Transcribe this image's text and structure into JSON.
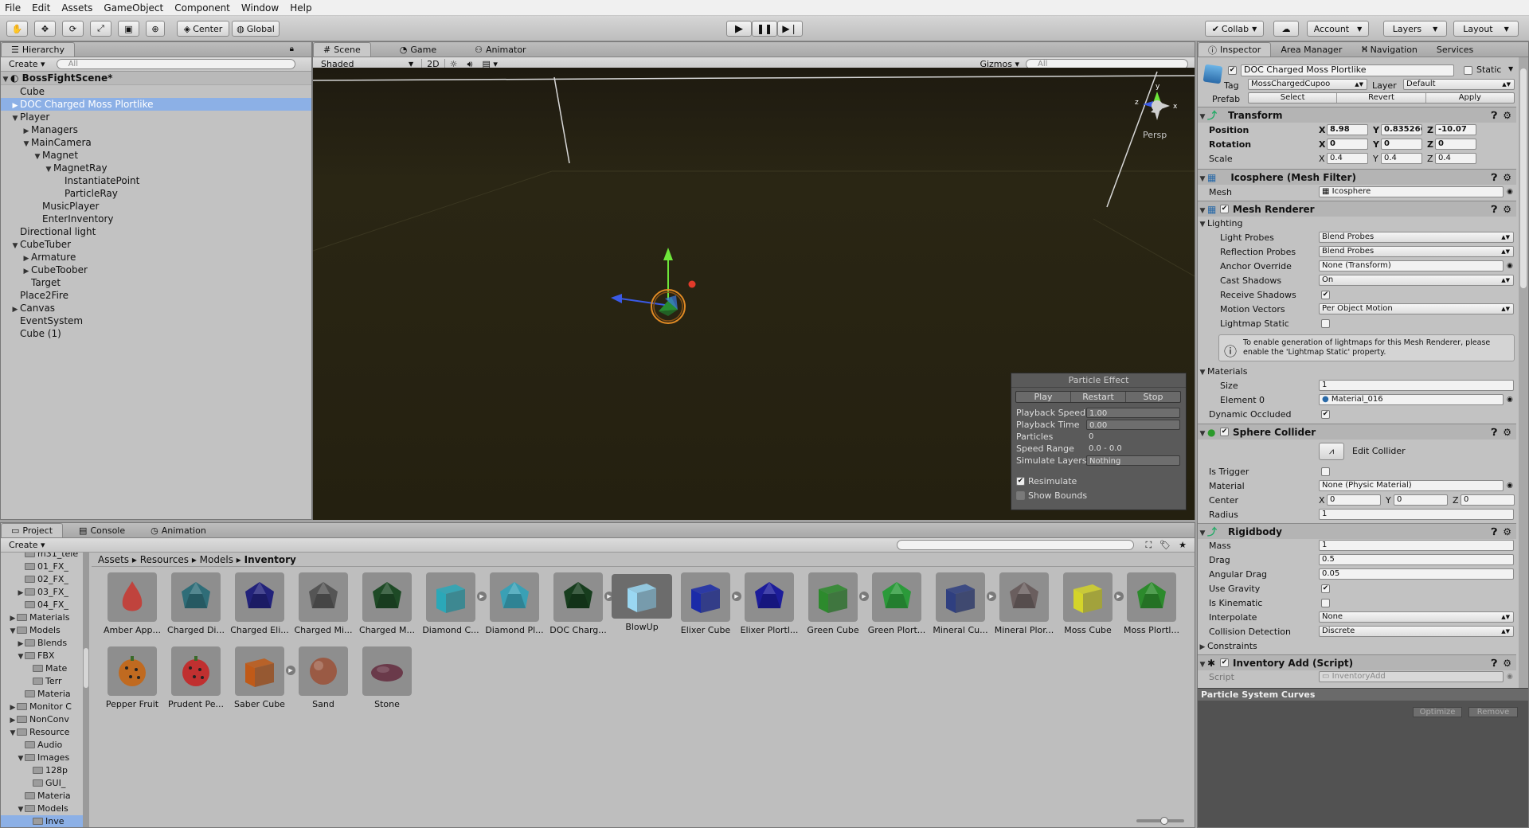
{
  "menu": [
    "File",
    "Edit",
    "Assets",
    "GameObject",
    "Component",
    "Window",
    "Help"
  ],
  "toolbar": {
    "pivot": "Center",
    "space": "Global",
    "collab": "Collab",
    "account": "Account",
    "layers": "Layers",
    "layout": "Layout"
  },
  "hierarchy": {
    "tab": "Hierarchy",
    "create": "Create",
    "search": "All",
    "scene": "BossFightScene*",
    "items": [
      {
        "label": "Cube",
        "depth": 0,
        "arrow": ""
      },
      {
        "label": "DOC Charged Moss Plortlike",
        "depth": 0,
        "arrow": "▶",
        "selected": true
      },
      {
        "label": "Player",
        "depth": 0,
        "arrow": "▼"
      },
      {
        "label": "Managers",
        "depth": 1,
        "arrow": "▶"
      },
      {
        "label": "MainCamera",
        "depth": 1,
        "arrow": "▼"
      },
      {
        "label": "Magnet",
        "depth": 2,
        "arrow": "▼"
      },
      {
        "label": "MagnetRay",
        "depth": 3,
        "arrow": "▼"
      },
      {
        "label": "InstantiatePoint",
        "depth": 4,
        "arrow": ""
      },
      {
        "label": "ParticleRay",
        "depth": 4,
        "arrow": ""
      },
      {
        "label": "MusicPlayer",
        "depth": 2,
        "arrow": ""
      },
      {
        "label": "EnterInventory",
        "depth": 2,
        "arrow": ""
      },
      {
        "label": "Directional light",
        "depth": 0,
        "arrow": ""
      },
      {
        "label": "CubeTuber",
        "depth": 0,
        "arrow": "▼"
      },
      {
        "label": "Armature",
        "depth": 1,
        "arrow": "▶"
      },
      {
        "label": "CubeToober",
        "depth": 1,
        "arrow": "▶"
      },
      {
        "label": "Target",
        "depth": 1,
        "arrow": ""
      },
      {
        "label": "Place2Fire",
        "depth": 0,
        "arrow": ""
      },
      {
        "label": "Canvas",
        "depth": 0,
        "arrow": "▶"
      },
      {
        "label": "EventSystem",
        "depth": 0,
        "arrow": ""
      },
      {
        "label": "Cube (1)",
        "depth": 0,
        "arrow": ""
      }
    ]
  },
  "scene": {
    "tabs": [
      "Scene",
      "Game",
      "Animator"
    ],
    "shading": "Shaded",
    "mode2d": "2D",
    "gizmos": "Gizmos",
    "search": "All",
    "persp": "Persp",
    "axis_x": "x",
    "axis_y": "y",
    "axis_z": "z"
  },
  "particle": {
    "title": "Particle Effect",
    "play": "Play",
    "restart": "Restart",
    "stop": "Stop",
    "rows": [
      {
        "label": "Playback Speed",
        "value": "1.00",
        "field": true
      },
      {
        "label": "Playback Time",
        "value": "0.00",
        "field": true
      },
      {
        "label": "Particles",
        "value": "0",
        "field": false
      },
      {
        "label": "Speed Range",
        "value": "0.0 - 0.0",
        "field": false
      },
      {
        "label": "Simulate Layers",
        "value": "Nothing",
        "field": true
      }
    ],
    "resimulate": "Resimulate",
    "show_bounds": "Show Bounds"
  },
  "inspector": {
    "tabs": [
      "Inspector",
      "Area Manager",
      "Navigation",
      "Services"
    ],
    "object_name": "DOC Charged Moss Plortlike",
    "static": "Static",
    "tag_label": "Tag",
    "tag": "MossChargedCupoo",
    "layer_label": "Layer",
    "layer": "Default",
    "prefab_label": "Prefab",
    "prefab_select": "Select",
    "prefab_revert": "Revert",
    "prefab_apply": "Apply",
    "transform": {
      "title": "Transform",
      "position": {
        "label": "Position",
        "x": "8.98",
        "y": "0.835266",
        "z": "-10.07"
      },
      "rotation": {
        "label": "Rotation",
        "x": "0",
        "y": "0",
        "z": "0"
      },
      "scale": {
        "label": "Scale",
        "x": "0.4",
        "y": "0.4",
        "z": "0.4"
      }
    },
    "mesh_filter": {
      "title": "Icosphere (Mesh Filter)",
      "mesh_label": "Mesh",
      "mesh": "Icosphere"
    },
    "mesh_renderer": {
      "title": "Mesh Renderer",
      "lighting": "Lighting",
      "light_probes_label": "Light Probes",
      "light_probes": "Blend Probes",
      "reflection_probes_label": "Reflection Probes",
      "reflection_probes": "Blend Probes",
      "anchor_override_label": "Anchor Override",
      "anchor_override": "None (Transform)",
      "cast_shadows_label": "Cast Shadows",
      "cast_shadows": "On",
      "receive_shadows_label": "Receive Shadows",
      "motion_vectors_label": "Motion Vectors",
      "motion_vectors": "Per Object Motion",
      "lightmap_static_label": "Lightmap Static",
      "info": "To enable generation of lightmaps for this Mesh Renderer, please enable the 'Lightmap Static' property.",
      "materials": "Materials",
      "size_label": "Size",
      "size": "1",
      "element0_label": "Element 0",
      "element0": "Material_016",
      "dynamic_occluded_label": "Dynamic Occluded"
    },
    "sphere_collider": {
      "title": "Sphere Collider",
      "edit_collider": "Edit Collider",
      "is_trigger_label": "Is Trigger",
      "material_label": "Material",
      "material": "None (Physic Material)",
      "center_label": "Center",
      "cx": "0",
      "cy": "0",
      "cz": "0",
      "radius_label": "Radius",
      "radius": "1"
    },
    "rigidbody": {
      "title": "Rigidbody",
      "mass_label": "Mass",
      "mass": "1",
      "drag_label": "Drag",
      "drag": "0.5",
      "angular_drag_label": "Angular Drag",
      "angular_drag": "0.05",
      "use_gravity_label": "Use Gravity",
      "is_kinematic_label": "Is Kinematic",
      "interpolate_label": "Interpolate",
      "interpolate": "None",
      "collision_detection_label": "Collision Detection",
      "collision_detection": "Discrete",
      "constraints": "Constraints"
    },
    "inventory": {
      "title": "Inventory Add (Script)",
      "script_label": "Script",
      "script": "InventoryAdd"
    },
    "curves": {
      "title": "Particle System Curves",
      "optimize": "Optimize",
      "remove": "Remove"
    }
  },
  "project": {
    "tabs": [
      "Project",
      "Console",
      "Animation"
    ],
    "create": "Create",
    "breadcrumb": [
      "Assets",
      "Resources",
      "Models",
      "Inventory"
    ],
    "tree": [
      {
        "label": "m31_tele",
        "indent": 2,
        "arrow": ""
      },
      {
        "label": "01_FX_",
        "indent": 2,
        "arrow": ""
      },
      {
        "label": "02_FX_",
        "indent": 2,
        "arrow": ""
      },
      {
        "label": "03_FX_",
        "indent": 2,
        "arrow": "▶"
      },
      {
        "label": "04_FX_",
        "indent": 2,
        "arrow": ""
      },
      {
        "label": "Materials",
        "indent": 1,
        "arrow": "▶"
      },
      {
        "label": "Models",
        "indent": 1,
        "arrow": "▼"
      },
      {
        "label": "Blends",
        "indent": 2,
        "arrow": "▶"
      },
      {
        "label": "FBX",
        "indent": 2,
        "arrow": "▼"
      },
      {
        "label": "Mate",
        "indent": 3,
        "arrow": ""
      },
      {
        "label": "Terr",
        "indent": 3,
        "arrow": ""
      },
      {
        "label": "Materia",
        "indent": 2,
        "arrow": ""
      },
      {
        "label": "Monitor C",
        "indent": 1,
        "arrow": "▶"
      },
      {
        "label": "NonConv",
        "indent": 1,
        "arrow": "▶"
      },
      {
        "label": "Resource",
        "indent": 1,
        "arrow": "▼"
      },
      {
        "label": "Audio",
        "indent": 2,
        "arrow": ""
      },
      {
        "label": "Images",
        "indent": 2,
        "arrow": "▼"
      },
      {
        "label": "128p",
        "indent": 3,
        "arrow": ""
      },
      {
        "label": "GUI_",
        "indent": 3,
        "arrow": ""
      },
      {
        "label": "Materia",
        "indent": 2,
        "arrow": ""
      },
      {
        "label": "Models",
        "indent": 2,
        "arrow": "▼"
      },
      {
        "label": "Inve",
        "indent": 3,
        "arrow": "",
        "selected": true
      }
    ],
    "assets": [
      {
        "label": "Amber App...",
        "shape": "apple",
        "color": "#c0433d"
      },
      {
        "label": "Charged Di...",
        "shape": "gem",
        "color": "#2f6d78"
      },
      {
        "label": "Charged Eli...",
        "shape": "gem",
        "color": "#22227a"
      },
      {
        "label": "Charged Mi...",
        "shape": "gem",
        "color": "#555"
      },
      {
        "label": "Charged M...",
        "shape": "gem",
        "color": "#1e4a26"
      },
      {
        "label": "Diamond C...",
        "shape": "cube",
        "color": "#2ba8b8",
        "arrow": true
      },
      {
        "label": "Diamond Pl...",
        "shape": "gem",
        "color": "#3aa0b5"
      },
      {
        "label": "DOC Charg...",
        "shape": "gem",
        "color": "#173d1e",
        "arrow": true
      },
      {
        "label": "BlowUp",
        "shape": "cube",
        "color": "#9ad7f2",
        "big": true
      },
      {
        "label": "Elixer Cube",
        "shape": "cube",
        "color": "#1b2ba8",
        "arrow": true
      },
      {
        "label": "Elixer Plortl...",
        "shape": "gem",
        "color": "#1c1c9a"
      },
      {
        "label": "Green Cube",
        "shape": "cube",
        "color": "#2d8a2d",
        "arrow": true
      },
      {
        "label": "Green Plort...",
        "shape": "gem",
        "color": "#2b9a3a"
      },
      {
        "label": "Mineral Cu...",
        "shape": "cube",
        "color": "#2f3f80",
        "arrow": true
      },
      {
        "label": "Mineral Plor...",
        "shape": "gem",
        "color": "#6a5e5e"
      },
      {
        "label": "Moss Cube",
        "shape": "cube",
        "color": "#d4d42a",
        "arrow": true
      },
      {
        "label": "Moss Plortl...",
        "shape": "gem",
        "color": "#2c8a2c"
      },
      {
        "label": "Pepper Fruit",
        "shape": "fruit",
        "color": "#c06a20"
      },
      {
        "label": "Prudent Pe...",
        "shape": "fruit",
        "color": "#c03030"
      },
      {
        "label": "Saber Cube",
        "shape": "cube",
        "color": "#c05a18",
        "arrow": true
      },
      {
        "label": "Sand",
        "shape": "sphere",
        "color": "#9a5a44"
      },
      {
        "label": "Stone",
        "shape": "stone",
        "color": "#6a3a4a"
      }
    ]
  }
}
